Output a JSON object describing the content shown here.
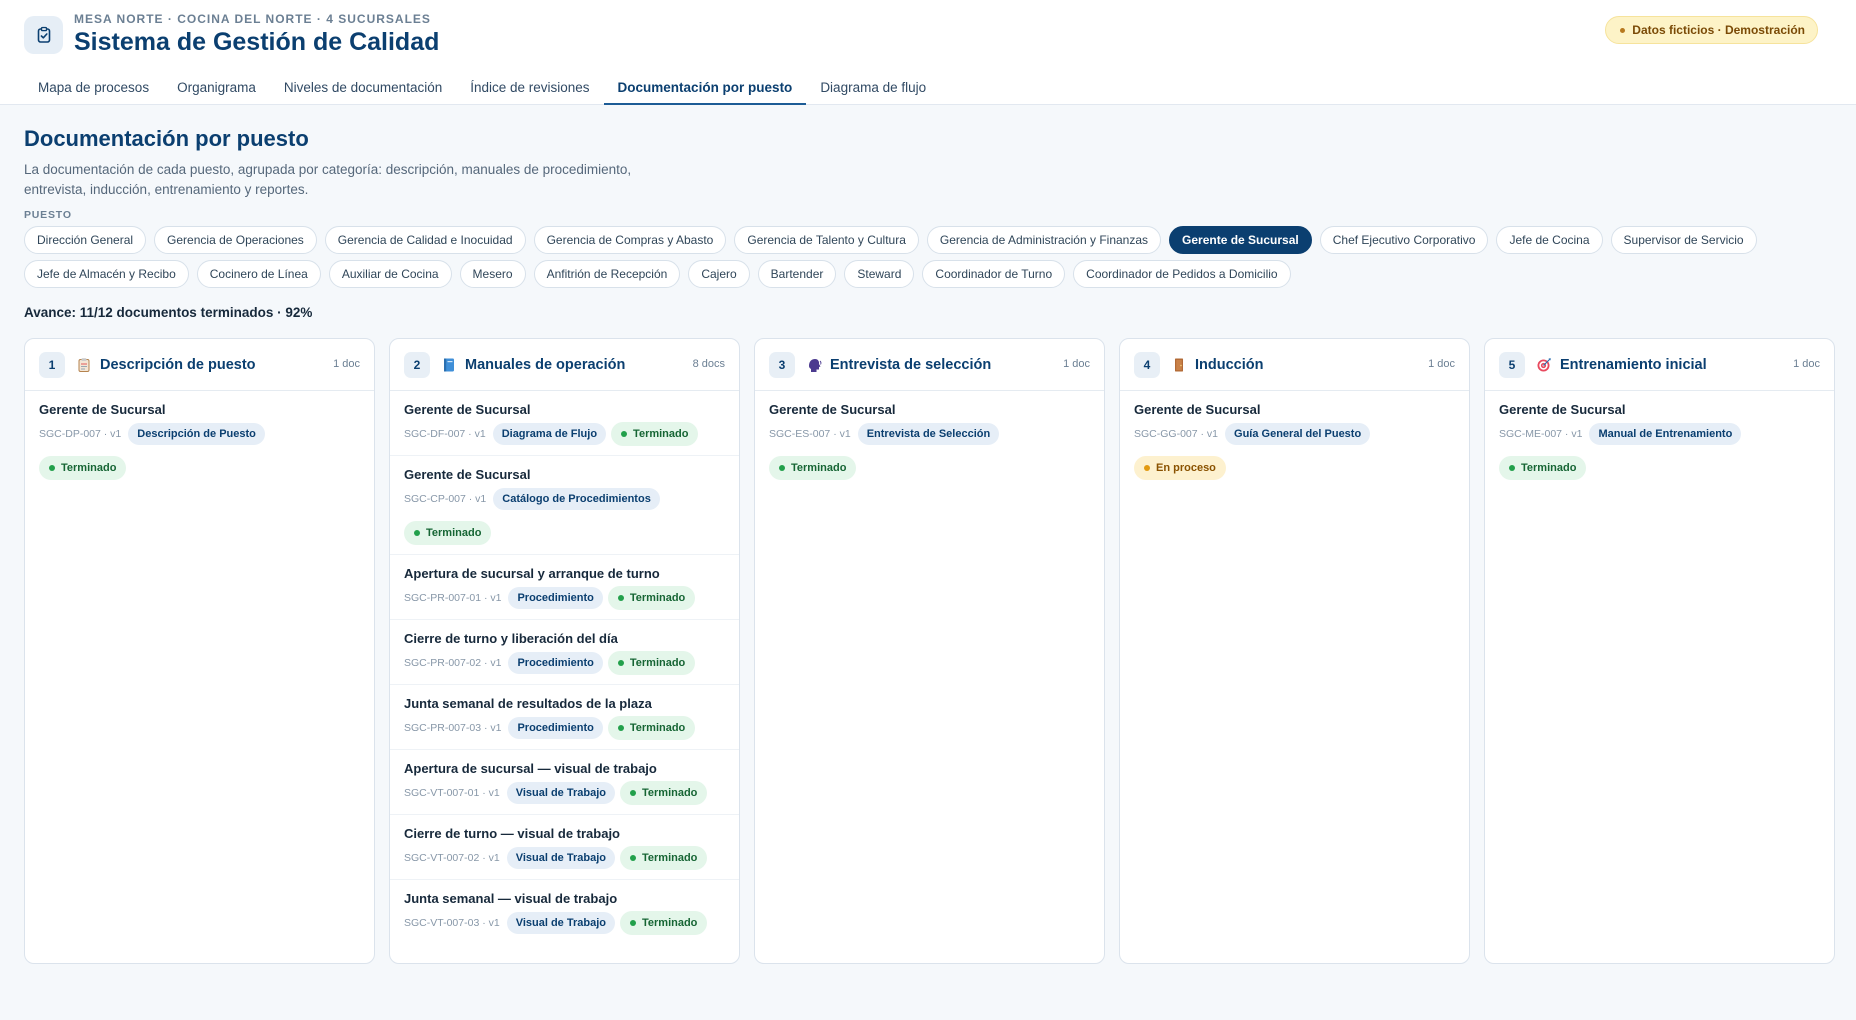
{
  "header": {
    "eyebrow": "MESA NORTE · COCINA DEL NORTE · 4 SUCURSALES",
    "title": "Sistema de Gestión de Calidad",
    "icon": "clipboard-check-icon",
    "badge": "Datos ficticios · Demostración"
  },
  "tabs": [
    {
      "label": "Mapa de procesos"
    },
    {
      "label": "Organigrama"
    },
    {
      "label": "Niveles de documentación"
    },
    {
      "label": "Índice de revisiones"
    },
    {
      "label": "Documentación por puesto",
      "active": true
    },
    {
      "label": "Diagrama de flujo"
    }
  ],
  "page": {
    "title": "Documentación por puesto",
    "description": "La documentación de cada puesto, agrupada por categoría: descripción, manuales de procedimiento, entrevista, inducción, entrenamiento y reportes.",
    "puesto_label": "PUESTO",
    "progress": "Avance: 11/12 documentos terminados · 92%"
  },
  "puestos": [
    "Dirección General",
    "Gerencia de Operaciones",
    "Gerencia de Calidad e Inocuidad",
    "Gerencia de Compras y Abasto",
    "Gerencia de Talento y Cultura",
    "Gerencia de Administración y Finanzas",
    "Gerente de Sucursal",
    "Chef Ejecutivo Corporativo",
    "Jefe de Cocina",
    "Supervisor de Servicio",
    "Jefe de Almacén y Recibo",
    "Cocinero de Línea",
    "Auxiliar de Cocina",
    "Mesero",
    "Anfitrión de Recepción",
    "Cajero",
    "Bartender",
    "Steward",
    "Coordinador de Turno",
    "Coordinador de Pedidos a Domicilio"
  ],
  "selected_puesto": "Gerente de Sucursal",
  "columns": [
    {
      "num": "1",
      "icon": "clipboard-icon",
      "title": "Descripción de puesto",
      "count": "1 doc",
      "docs": [
        {
          "title": "Gerente de Sucursal",
          "code": "SGC-DP-007 · v1",
          "tag": "Descripción de Puesto",
          "status": "Terminado",
          "status_kind": "done",
          "status_newline": true
        }
      ]
    },
    {
      "num": "2",
      "icon": "book-icon",
      "title": "Manuales de operación",
      "count": "8 docs",
      "docs": [
        {
          "title": "Gerente de Sucursal",
          "code": "SGC-DF-007 · v1",
          "tag": "Diagrama de Flujo",
          "status": "Terminado",
          "status_kind": "done"
        },
        {
          "title": "Gerente de Sucursal",
          "code": "SGC-CP-007 · v1",
          "tag": "Catálogo de Procedimientos",
          "status": "Terminado",
          "status_kind": "done",
          "status_newline": true
        },
        {
          "title": "Apertura de sucursal y arranque de turno",
          "code": "SGC-PR-007-01 · v1",
          "tag": "Procedimiento",
          "status": "Terminado",
          "status_kind": "done"
        },
        {
          "title": "Cierre de turno y liberación del día",
          "code": "SGC-PR-007-02 · v1",
          "tag": "Procedimiento",
          "status": "Terminado",
          "status_kind": "done"
        },
        {
          "title": "Junta semanal de resultados de la plaza",
          "code": "SGC-PR-007-03 · v1",
          "tag": "Procedimiento",
          "status": "Terminado",
          "status_kind": "done"
        },
        {
          "title": "Apertura de sucursal — visual de trabajo",
          "code": "SGC-VT-007-01 · v1",
          "tag": "Visual de Trabajo",
          "status": "Terminado",
          "status_kind": "done"
        },
        {
          "title": "Cierre de turno — visual de trabajo",
          "code": "SGC-VT-007-02 · v1",
          "tag": "Visual de Trabajo",
          "status": "Terminado",
          "status_kind": "done"
        },
        {
          "title": "Junta semanal — visual de trabajo",
          "code": "SGC-VT-007-03 · v1",
          "tag": "Visual de Trabajo",
          "status": "Terminado",
          "status_kind": "done"
        }
      ]
    },
    {
      "num": "3",
      "icon": "speaking-head-icon",
      "title": "Entrevista de selección",
      "count": "1 doc",
      "docs": [
        {
          "title": "Gerente de Sucursal",
          "code": "SGC-ES-007 · v1",
          "tag": "Entrevista de Selección",
          "status": "Terminado",
          "status_kind": "done",
          "status_newline": true
        }
      ]
    },
    {
      "num": "4",
      "icon": "door-icon",
      "title": "Inducción",
      "count": "1 doc",
      "docs": [
        {
          "title": "Gerente de Sucursal",
          "code": "SGC-GG-007 · v1",
          "tag": "Guía General del Puesto",
          "status": "En proceso",
          "status_kind": "prog",
          "status_newline": true
        }
      ]
    },
    {
      "num": "5",
      "icon": "target-icon",
      "title": "Entrenamiento inicial",
      "count": "1 doc",
      "docs": [
        {
          "title": "Gerente de Sucursal",
          "code": "SGC-ME-007 · v1",
          "tag": "Manual de Entrenamiento",
          "status": "Terminado",
          "status_kind": "done",
          "status_newline": true
        }
      ]
    }
  ],
  "colors": {
    "primary": "#0b3f70",
    "done_bg": "#e4f6ea",
    "done_dot": "#22a04b",
    "progress_bg": "#fdf1cf",
    "progress_dot": "#e29a12",
    "badge_bg": "#fdf3c7"
  }
}
